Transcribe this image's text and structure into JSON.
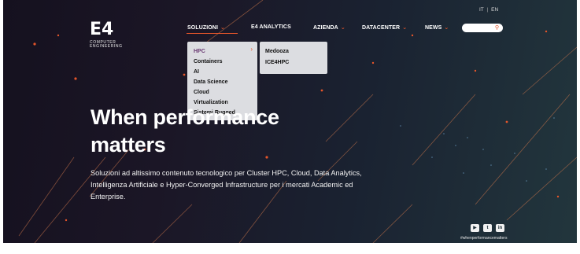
{
  "lang": {
    "it": "IT",
    "sep": "|",
    "en": "EN"
  },
  "logo": {
    "mark": "E4",
    "sub_line1": "COMPUTER",
    "sub_line2": "ENGINEERING"
  },
  "nav": {
    "items": [
      {
        "label": "SOLUZIONI",
        "has_dropdown": true,
        "active": true
      },
      {
        "label": "E4 ANALYTICS",
        "has_dropdown": false
      },
      {
        "label": "AZIENDA",
        "has_dropdown": true
      },
      {
        "label": "DATACENTER",
        "has_dropdown": true
      },
      {
        "label": "NEWS",
        "has_dropdown": true
      }
    ],
    "search_placeholder": ""
  },
  "dropdown": {
    "items": [
      "HPC",
      "Containers",
      "AI",
      "Data Science",
      "Cloud",
      "Virtualization",
      "Sistemi Rugged"
    ],
    "submenu": [
      "Medooza",
      "ICE4HPC"
    ]
  },
  "hero": {
    "title_line1": "When performance",
    "title_line2": "matters",
    "subtitle": "Soluzioni ad altissimo contenuto tecnologico per Cluster HPC, Cloud, Data Analytics, Intelligenza Artificiale e Hyper-Converged Infrastructure per i mercati Academic ed Enterprise."
  },
  "social": {
    "youtube": "▶",
    "twitter": "t",
    "linkedin": "in",
    "hashtag": "#whenperformancematters"
  },
  "colors": {
    "accent": "#e4552a",
    "menu_bg": "#dcdde1",
    "bg_dark": "#15111f"
  },
  "icons": {
    "search": "search-icon",
    "chevron": "chevron-down-icon",
    "arrow": "chevron-right-icon"
  }
}
